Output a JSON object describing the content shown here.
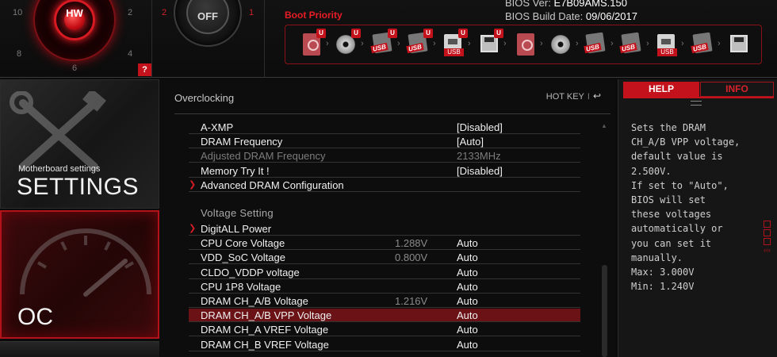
{
  "colors": {
    "accent": "#c3121b",
    "selected_row": "#6a1216",
    "background": "#0d0d0d"
  },
  "top": {
    "game_boost": {
      "label": "HW",
      "dial_numbers": [
        "10",
        "2",
        "8",
        "4",
        "6"
      ],
      "help_button": "?"
    },
    "xmp": {
      "label": "OFF",
      "left_number": "2",
      "right_number": "1"
    },
    "bios_version_label": "BIOS Ver:",
    "bios_version": "E7B09AMS.150",
    "bios_build_label": "BIOS Build Date:",
    "bios_build_date": "09/06/2017",
    "boot_priority_label": "Boot Priority",
    "boot_devices": [
      {
        "icon": "hdd-icon",
        "uefi": true
      },
      {
        "icon": "optical-disc-icon",
        "uefi": true
      },
      {
        "icon": "usb-drive-icon",
        "uefi": true,
        "tag": "USB"
      },
      {
        "icon": "usb-drive-icon",
        "uefi": true,
        "tag": "USB"
      },
      {
        "icon": "usb-network-icon",
        "uefi": true,
        "tag": "USB"
      },
      {
        "icon": "floppy-icon",
        "uefi": true
      },
      {
        "icon": "hdd-icon",
        "uefi": false
      },
      {
        "icon": "optical-disc-icon",
        "uefi": false
      },
      {
        "icon": "usb-drive-icon",
        "uefi": false,
        "tag": "USB"
      },
      {
        "icon": "usb-drive-icon",
        "uefi": false,
        "tag": "USB"
      },
      {
        "icon": "usb-network-icon",
        "uefi": false,
        "tag": "USB"
      },
      {
        "icon": "usb-drive-icon",
        "uefi": false,
        "tag": "USB"
      },
      {
        "icon": "floppy-icon",
        "uefi": false
      }
    ],
    "uefi_badge": "U"
  },
  "nav": {
    "settings_sub": "Motherboard settings",
    "settings_label": "SETTINGS",
    "oc_label": "OC"
  },
  "main": {
    "title": "Overclocking",
    "hotkey_label": "HOT KEY",
    "hotkey_sep": "I",
    "back_icon": "↩",
    "scroll_up": "▲",
    "rows": [
      {
        "name": "A-XMP",
        "current": "",
        "value": "[Disabled]",
        "state": "normal",
        "submenu": false
      },
      {
        "name": "DRAM Frequency",
        "current": "",
        "value": "[Auto]",
        "state": "normal",
        "submenu": false
      },
      {
        "name": "Adjusted DRAM Frequency",
        "current": "",
        "value": "2133MHz",
        "state": "disabled",
        "submenu": false
      },
      {
        "name": "Memory Try It !",
        "current": "",
        "value": "[Disabled]",
        "state": "normal",
        "submenu": false
      },
      {
        "name": "Advanced DRAM Configuration",
        "current": "",
        "value": "",
        "state": "normal",
        "submenu": true
      }
    ],
    "section_voltage": "Voltage Setting",
    "voltage_rows": [
      {
        "name": "DigitALL Power",
        "current": "",
        "value": "",
        "state": "normal",
        "submenu": true
      },
      {
        "name": "CPU Core Voltage",
        "current": "1.288V",
        "value": "Auto",
        "state": "normal",
        "submenu": false
      },
      {
        "name": "VDD_SoC Voltage",
        "current": "0.800V",
        "value": "Auto",
        "state": "normal",
        "submenu": false
      },
      {
        "name": "CLDO_VDDP voltage",
        "current": "",
        "value": "Auto",
        "state": "normal",
        "submenu": false
      },
      {
        "name": "CPU 1P8 Voltage",
        "current": "",
        "value": "Auto",
        "state": "normal",
        "submenu": false
      },
      {
        "name": "DRAM CH_A/B Voltage",
        "current": "1.216V",
        "value": "Auto",
        "state": "normal",
        "submenu": false
      },
      {
        "name": "DRAM CH_A/B VPP Voltage",
        "current": "",
        "value": "Auto",
        "state": "selected",
        "submenu": false
      },
      {
        "name": "DRAM CH_A VREF Voltage",
        "current": "",
        "value": "Auto",
        "state": "normal",
        "submenu": false
      },
      {
        "name": "DRAM CH_B VREF Voltage",
        "current": "",
        "value": "Auto",
        "state": "normal",
        "submenu": false
      }
    ]
  },
  "help": {
    "tab_help": "HELP",
    "tab_info": "INFO",
    "text": "Sets the DRAM\nCH_A/B VPP voltage,\ndefault value is\n2.500V.\nIf set to \"Auto\",\nBIOS will set\nthese voltages\nautomatically or\nyou can set it\nmanually.\nMax: 3.000V\nMin: 1.240V",
    "side_dots": "‹‹‹"
  }
}
